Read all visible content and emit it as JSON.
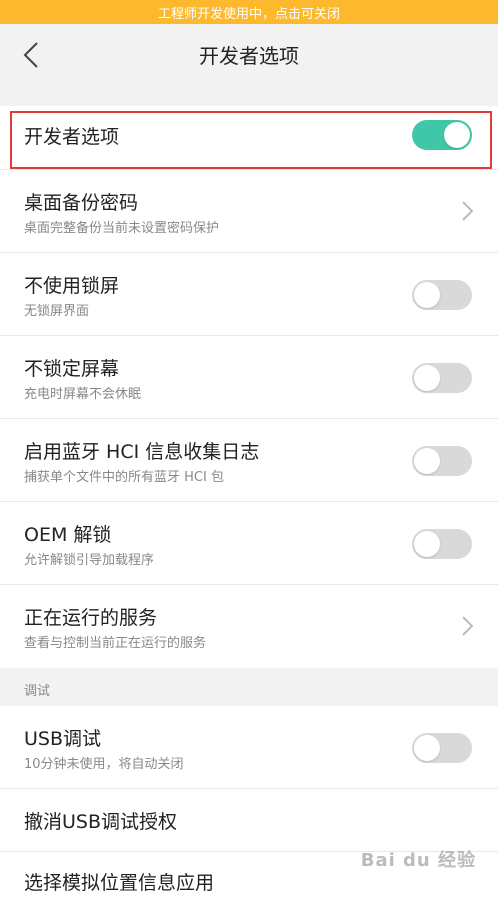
{
  "banner": {
    "text": "工程师开发使用中，点击可关闭"
  },
  "header": {
    "title": "开发者选项"
  },
  "rows": [
    {
      "title": "开发者选项",
      "subtitle": "",
      "control": "toggle",
      "on": true
    },
    {
      "title": "桌面备份密码",
      "subtitle": "桌面完整备份当前未设置密码保护",
      "control": "chevron"
    },
    {
      "title": "不使用锁屏",
      "subtitle": "无锁屏界面",
      "control": "toggle",
      "on": false
    },
    {
      "title": "不锁定屏幕",
      "subtitle": "充电时屏幕不会休眠",
      "control": "toggle",
      "on": false
    },
    {
      "title": "启用蓝牙 HCI 信息收集日志",
      "subtitle": "捕获单个文件中的所有蓝牙 HCI 包",
      "control": "toggle",
      "on": false
    },
    {
      "title": "OEM 解锁",
      "subtitle": "允许解锁引导加载程序",
      "control": "toggle",
      "on": false
    },
    {
      "title": "正在运行的服务",
      "subtitle": "查看与控制当前正在运行的服务",
      "control": "chevron"
    }
  ],
  "section": {
    "label": "调试"
  },
  "debug_rows": [
    {
      "title": "USB调试",
      "subtitle": "10分钟未使用，将自动关闭",
      "control": "toggle",
      "on": false
    },
    {
      "title": "撤消USB调试授权",
      "subtitle": "",
      "control": "none"
    },
    {
      "title": "选择模拟位置信息应用",
      "subtitle": "",
      "control": "none"
    }
  ],
  "watermark": {
    "text": "Bai du 经验"
  },
  "colors": {
    "accent": "#3fc7a8",
    "banner": "#fdb92e",
    "highlight": "#e03a3a"
  }
}
